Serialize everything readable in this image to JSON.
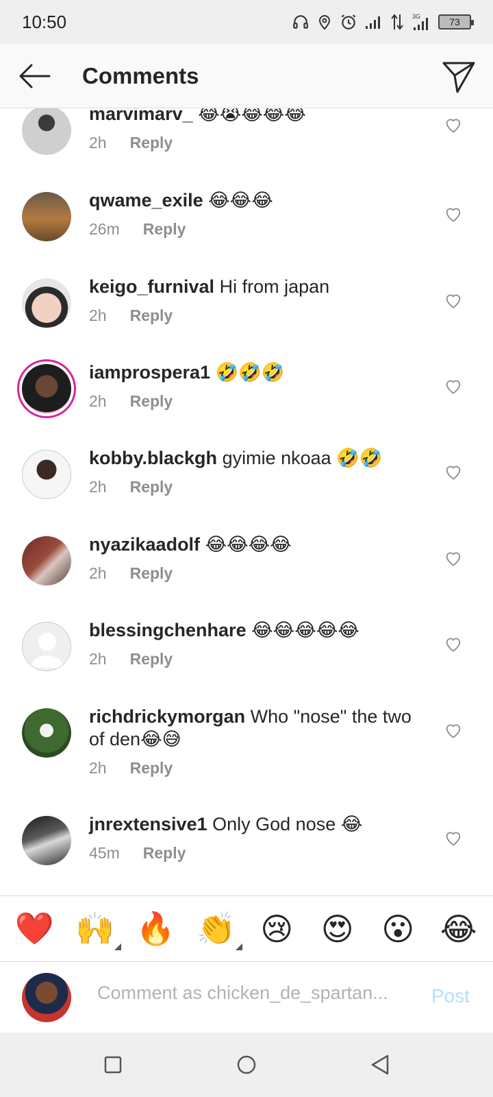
{
  "status_bar": {
    "time": "10:50",
    "battery": "73",
    "network": "3G"
  },
  "header": {
    "title": "Comments"
  },
  "comments": [
    {
      "username": "marvimarv_",
      "text": "😂😭😂😂😂",
      "time": "2h",
      "reply": "Reply"
    },
    {
      "username": "qwame_exile",
      "text": "😂😂😂",
      "time": "26m",
      "reply": "Reply"
    },
    {
      "username": "keigo_furnival",
      "text": "Hi from japan",
      "time": "2h",
      "reply": "Reply"
    },
    {
      "username": "iamprospera1",
      "text": "🤣🤣🤣",
      "time": "2h",
      "reply": "Reply"
    },
    {
      "username": "kobby.blackgh",
      "text": "gyimie nkoaa 🤣🤣",
      "time": "2h",
      "reply": "Reply"
    },
    {
      "username": "nyazikaadolf",
      "text": "😂😂😂😂",
      "time": "2h",
      "reply": "Reply"
    },
    {
      "username": "blessingchenhare",
      "text": "😂😂😂😂😂",
      "time": "2h",
      "reply": "Reply"
    },
    {
      "username": "richdrickymorgan",
      "text": "Who \"nose\" the two of den😂😅",
      "time": "2h",
      "reply": "Reply"
    },
    {
      "username": "jnrextensive1",
      "text": "Only God nose 😂",
      "time": "45m",
      "reply": "Reply"
    }
  ],
  "reactions": [
    "❤️",
    "🙌",
    "🔥",
    "👏",
    "😢",
    "😍",
    "😮",
    "😂"
  ],
  "input": {
    "placeholder": "Comment as chicken_de_spartan...",
    "post_label": "Post"
  },
  "colors": {
    "accent": "#3897f0",
    "post_disabled": "#b2dffc",
    "muted": "#8e8e8e",
    "heart": "#ed4956"
  }
}
